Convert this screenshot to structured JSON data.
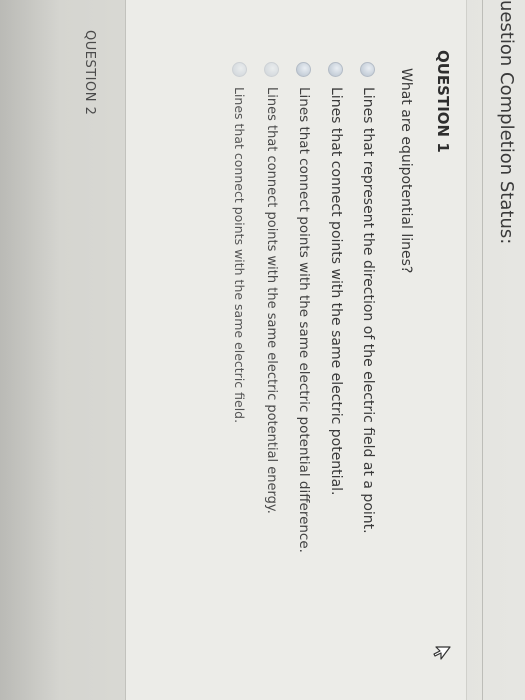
{
  "header": {
    "status_label": "uestion Completion Status:"
  },
  "question1": {
    "title": "QUESTION 1",
    "prompt": "What are equipotential lines?",
    "options": [
      "Lines that represent the direction of the electric field at a point.",
      "Lines that connect points with the same electric potential.",
      "Lines that connect points with the same electric potential difference.",
      "Lines that connect points with the same electric potential energy.",
      "Lines that connect points with the same electric field."
    ]
  },
  "question2": {
    "title": "QUESTION 2"
  },
  "icons": {
    "radio": "radio-button-icon",
    "cursor": "mouse-pointer-icon"
  },
  "colors": {
    "background": "#e6e6e2",
    "text": "#3a3a3a",
    "radio": "#c5ced8"
  }
}
